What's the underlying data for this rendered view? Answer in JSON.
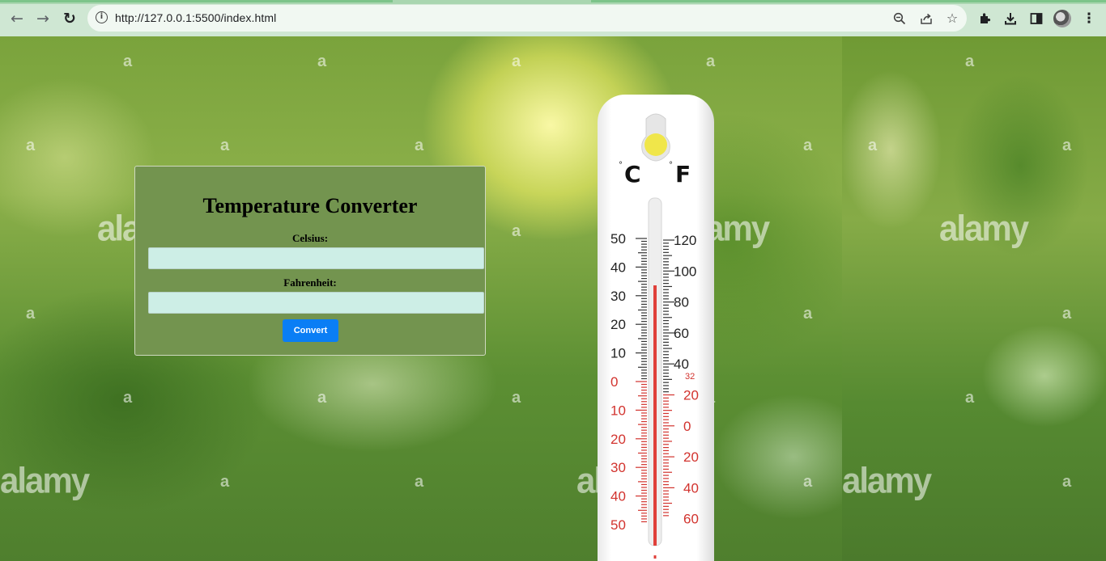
{
  "browser": {
    "url": "http://127.0.0.1:5500/index.html",
    "nav": {
      "back_icon": "arrow-left-icon",
      "forward_icon": "arrow-right-icon",
      "reload_icon": "reload-icon"
    },
    "omnibox_icons": [
      "site-info-icon",
      "zoom-icon",
      "share-icon",
      "bookmark-star-icon"
    ],
    "toolbar_icons": [
      "extensions-icon",
      "download-icon",
      "side-panel-icon",
      "profile-avatar",
      "menu-kebab-icon"
    ]
  },
  "page": {
    "watermark_small": "a",
    "watermark_big": "alamy"
  },
  "converter": {
    "title": "Temperature Converter",
    "celsius_label": "Celsius:",
    "celsius_value": "",
    "fahrenheit_label": "Fahrenheit:",
    "fahrenheit_value": "",
    "convert_label": "Convert"
  },
  "thermometer": {
    "celsius_unit": "C",
    "fahrenheit_unit": "F",
    "degree_sign": "°",
    "celsius_ticks": [
      "50",
      "40",
      "30",
      "20",
      "10",
      "0",
      "10",
      "20",
      "30",
      "40",
      "50"
    ],
    "fahrenheit_ticks": [
      "120",
      "100",
      "80",
      "60",
      "40",
      "20",
      "0",
      "20",
      "40",
      "60"
    ],
    "freezing_mark": "32"
  },
  "colors": {
    "card_bg": "#73944f",
    "input_bg": "#cdeee6",
    "button_bg": "#0a7ef5",
    "mercury": "#e0403a",
    "chrome_bg": "#cfe7d3"
  }
}
